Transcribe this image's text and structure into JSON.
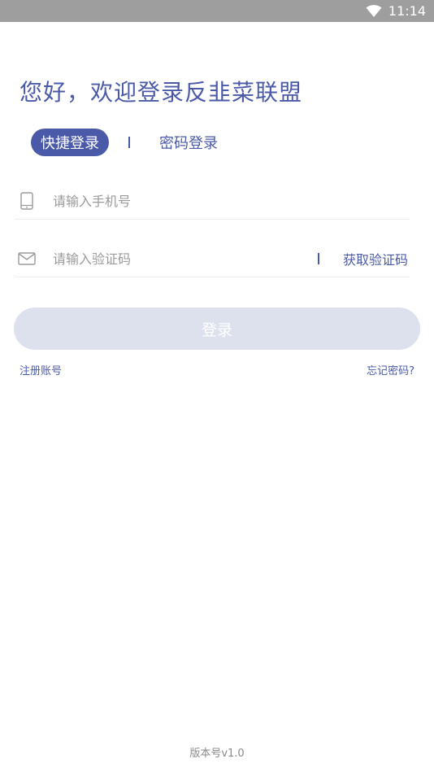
{
  "status_bar": {
    "time": "11:14",
    "wifi_icon": "wifi-icon"
  },
  "welcome": {
    "title": "您好，欢迎登录反韭菜联盟"
  },
  "tabs": {
    "quick_login": "快捷登录",
    "password_login": "密码登录"
  },
  "form": {
    "phone": {
      "icon": "phone-icon",
      "placeholder": "请输入手机号",
      "value": ""
    },
    "code": {
      "icon": "mail-icon",
      "placeholder": "请输入验证码",
      "value": "",
      "get_code_label": "获取验证码"
    },
    "login_label": "登录"
  },
  "links": {
    "register": "注册账号",
    "forgot_password": "忘记密码?"
  },
  "footer": {
    "version": "版本号v1.0"
  },
  "colors": {
    "accent": "#4a5aa8",
    "button_disabled": "#dde1ee",
    "status_bar": "#9e9e9e"
  }
}
